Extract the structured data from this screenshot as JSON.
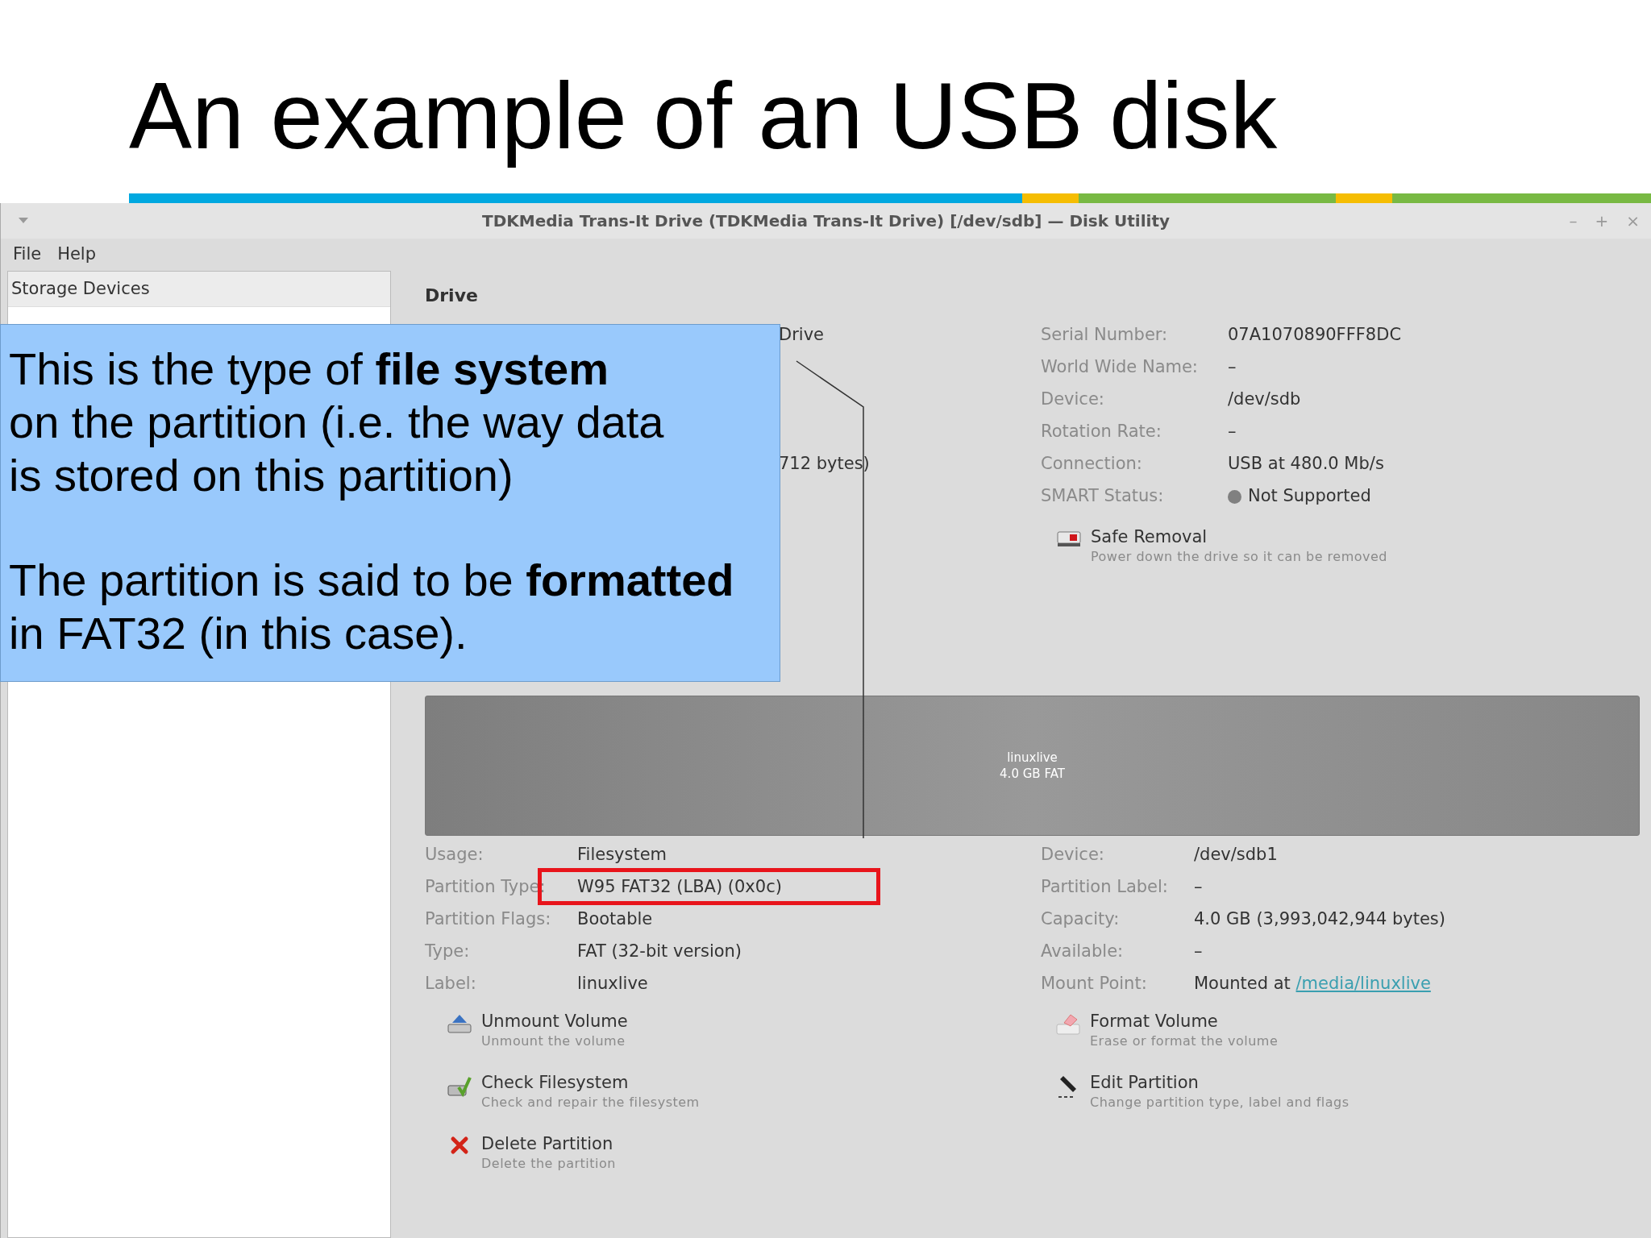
{
  "slide": {
    "title": "An example of an USB disk"
  },
  "window": {
    "title": "TDKMedia Trans-It Drive (TDKMedia Trans-It Drive) [/dev/sdb] — Disk Utility",
    "controls": [
      "–",
      "+",
      "×"
    ]
  },
  "menu": [
    "File",
    "Help"
  ],
  "sidebar": {
    "header": "Storage Devices"
  },
  "drive": {
    "heading": "Drive",
    "cut_texts": [
      "Drive",
      "712 bytes)"
    ],
    "info": [
      {
        "label": "Serial Number:",
        "value": "07A1070890FFF8DC",
        "kind": "text"
      },
      {
        "label": "World Wide Name:",
        "value": "–",
        "kind": "text"
      },
      {
        "label": "Device:",
        "value": "/dev/sdb",
        "kind": "text"
      },
      {
        "label": "Rotation Rate:",
        "value": "–",
        "kind": "text"
      },
      {
        "label": "Connection:",
        "value": "USB at 480.0 Mb/s",
        "kind": "text"
      },
      {
        "label": "SMART Status:",
        "value": "Not Supported",
        "kind": "status",
        "color": "#808080"
      }
    ],
    "action": {
      "title": "Safe Removal",
      "subtitle": "Power down the drive so it can be removed",
      "kind": "eject-drive"
    }
  },
  "partition_bar": {
    "label": "linuxlive",
    "size": "4.0 GB FAT"
  },
  "volume": {
    "left": [
      {
        "label": "Usage:",
        "value": "Filesystem"
      },
      {
        "label": "Partition Type:",
        "value": "W95 FAT32 (LBA) (0x0c)"
      },
      {
        "label": "Partition Flags:",
        "value": "Bootable"
      },
      {
        "label": "Type:",
        "value": "FAT (32-bit version)"
      },
      {
        "label": "Label:",
        "value": "linuxlive"
      }
    ],
    "right": [
      {
        "label": "Device:",
        "value": "/dev/sdb1"
      },
      {
        "label": "Partition Label:",
        "value": "–"
      },
      {
        "label": "Capacity:",
        "value": "4.0 GB (3,993,042,944 bytes)"
      },
      {
        "label": "Available:",
        "value": "–"
      },
      {
        "label": "Mount Point:",
        "value": "Mounted at",
        "link": "/media/linuxlive"
      }
    ]
  },
  "actions": [
    {
      "title": "Unmount Volume",
      "subtitle": "Unmount the volume",
      "kind": "unmount"
    },
    {
      "title": "Format Volume",
      "subtitle": "Erase or format the volume",
      "kind": "format"
    },
    {
      "title": "Check Filesystem",
      "subtitle": "Check and repair the filesystem",
      "kind": "check"
    },
    {
      "title": "Edit Partition",
      "subtitle": "Change partition type, label and flags",
      "kind": "edit"
    },
    {
      "title": "Delete Partition",
      "subtitle": "Delete the partition",
      "kind": "delete"
    }
  ],
  "callout": {
    "paragraphs": [
      "This is the type of **file system**\non the partition (i.e. the way data\nis stored on this partition)",
      "The partition is said to be **formatted**\nin FAT32 (in this case)."
    ]
  }
}
